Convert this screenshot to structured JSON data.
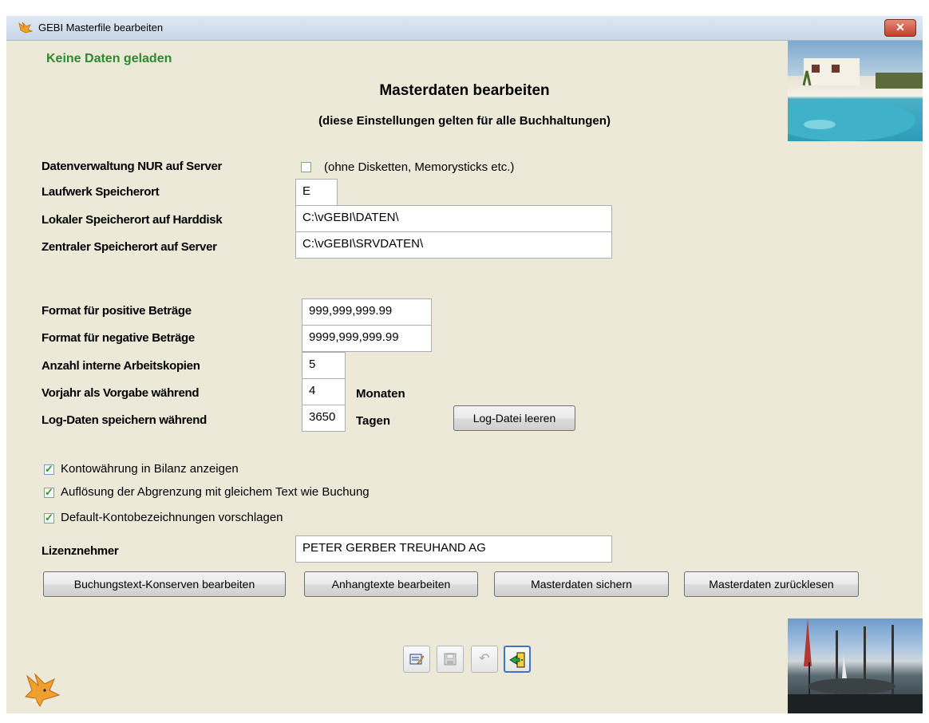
{
  "window": {
    "title": "GEBI  Masterfile bearbeiten",
    "close_label": "✕"
  },
  "status": "Keine Daten geladen",
  "heading": "Masterdaten bearbeiten",
  "subheading": "(diese Einstellungen gelten für alle Buchhaltungen)",
  "server_only": {
    "label": "Datenverwaltung NUR auf Server",
    "checked": false,
    "note": "(ohne Disketten, Memorysticks etc.)"
  },
  "drive": {
    "label": "Laufwerk Speicherort",
    "value": "E"
  },
  "local_path": {
    "label": "Lokaler Speicherort auf Harddisk",
    "value": "C:\\vGEBI\\DATEN\\"
  },
  "server_path": {
    "label": "Zentraler Speicherort auf Server",
    "value": "C:\\vGEBI\\SRVDATEN\\"
  },
  "format_positive": {
    "label": "Format für positive Beträge",
    "value": "999,999,999.99"
  },
  "format_negative": {
    "label": "Format für negative Beträge",
    "value": "9999,999,999.99"
  },
  "work_copies": {
    "label": "Anzahl interne Arbeitskopien",
    "value": "5"
  },
  "prev_year": {
    "label": "Vorjahr als Vorgabe während",
    "value": "4",
    "unit": "Monaten"
  },
  "log_days": {
    "label": "Log-Daten speichern während",
    "value": "3650",
    "unit": "Tagen",
    "button": "Log-Datei leeren"
  },
  "options": [
    {
      "label": "Kontowährung in Bilanz anzeigen",
      "checked": true
    },
    {
      "label": "Auflösung der Abgrenzung mit gleichem Text wie Buchung",
      "checked": true
    },
    {
      "label": "Default-Kontobezeichnungen vorschlagen",
      "checked": true
    }
  ],
  "licensee": {
    "label": "Lizenznehmer",
    "value": "PETER GERBER TREUHAND AG"
  },
  "buttons": {
    "booking_texts": "Buchungstext-Konserven bearbeiten",
    "appendix_texts": "Anhangtexte bearbeiten",
    "save_master": "Masterdaten sichern",
    "reload_master": "Masterdaten zurücklesen"
  },
  "toolbar": [
    {
      "icon": "edit-icon",
      "enabled": true
    },
    {
      "icon": "save-icon",
      "enabled": false
    },
    {
      "icon": "undo-icon",
      "enabled": false
    },
    {
      "icon": "exit-icon",
      "enabled": true
    }
  ]
}
